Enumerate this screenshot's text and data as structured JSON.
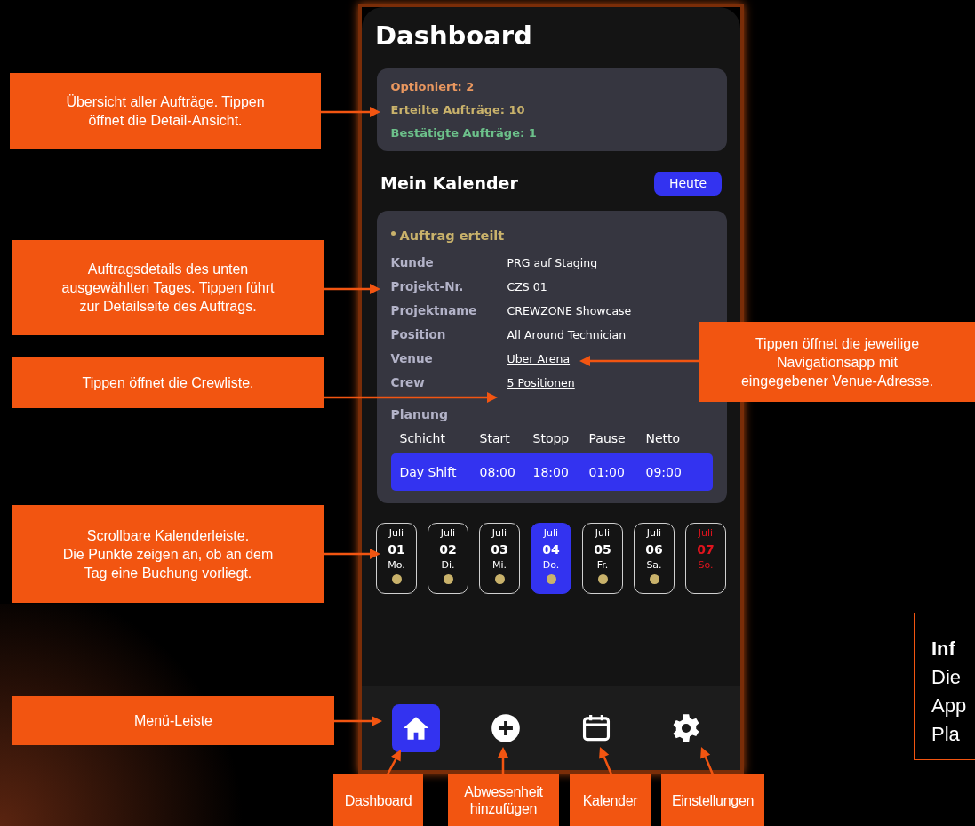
{
  "screen": {
    "title": "Dashboard",
    "summary": [
      {
        "text": "Optioniert: 2",
        "color": "#e9975f"
      },
      {
        "text": "Erteilte Aufträge: 10",
        "color": "#c9b26b"
      },
      {
        "text": "Bestätigte Aufträge: 1",
        "color": "#6cc08a"
      }
    ],
    "calendar_title": "Mein Kalender",
    "today_button": "Heute",
    "order": {
      "status": "Auftrag erteilt",
      "fields": [
        {
          "label": "Kunde",
          "value": "PRG auf Staging",
          "kind": "text"
        },
        {
          "label": "Projekt-Nr.",
          "value": "CZS 01",
          "kind": "text"
        },
        {
          "label": "Projektname",
          "value": "CREWZONE Showcase",
          "kind": "text"
        },
        {
          "label": "Position",
          "value": "All Around Technician",
          "kind": "text"
        },
        {
          "label": "Venue",
          "value": "Uber Arena",
          "kind": "link"
        },
        {
          "label": "Crew",
          "value": "5 Positionen",
          "kind": "link"
        }
      ],
      "planning_title": "Planung",
      "shift_columns": [
        "Schicht",
        "Start",
        "Stopp",
        "Pause",
        "Netto"
      ],
      "shifts": [
        {
          "cells": [
            "Day Shift",
            "08:00",
            "18:00",
            "01:00",
            "09:00"
          ],
          "selected": true
        }
      ]
    },
    "days": [
      {
        "month": "Juli",
        "day": "01",
        "weekday": "Mo.",
        "selected": false,
        "booked": true,
        "holiday": false
      },
      {
        "month": "Juli",
        "day": "02",
        "weekday": "Di.",
        "selected": false,
        "booked": true,
        "holiday": false
      },
      {
        "month": "Juli",
        "day": "03",
        "weekday": "Mi.",
        "selected": false,
        "booked": true,
        "holiday": false
      },
      {
        "month": "Juli",
        "day": "04",
        "weekday": "Do.",
        "selected": true,
        "booked": true,
        "holiday": false
      },
      {
        "month": "Juli",
        "day": "05",
        "weekday": "Fr.",
        "selected": false,
        "booked": true,
        "holiday": false
      },
      {
        "month": "Juli",
        "day": "06",
        "weekday": "Sa.",
        "selected": false,
        "booked": true,
        "holiday": false
      },
      {
        "month": "Juli",
        "day": "07",
        "weekday": "So.",
        "selected": false,
        "booked": false,
        "holiday": true
      }
    ],
    "nav": [
      {
        "kind": "home",
        "selected": true
      },
      {
        "kind": "add",
        "selected": false
      },
      {
        "kind": "calendar",
        "selected": false
      },
      {
        "kind": "settings",
        "selected": false
      }
    ]
  },
  "annotations": [
    {
      "lines": [
        "Übersicht aller Aufträge. Tippen",
        "öffnet die Detail-Ansicht."
      ]
    },
    {
      "lines": [
        "Auftragsdetails des unten",
        "ausgewählten Tages. Tippen führt",
        "zur Detailseite des Auftrags."
      ]
    },
    {
      "lines": [
        "Tippen öffnet die Crewliste."
      ]
    },
    {
      "lines": [
        "Scrollbare Kalenderleiste.",
        "Die Punkte zeigen an, ob an dem",
        "Tag eine Buchung vorliegt."
      ]
    },
    {
      "lines": [
        "Menü-Leiste"
      ]
    },
    {
      "lines": [
        "Tippen öffnet die jeweilige",
        "Navigationsapp mit",
        "eingegebener Venue-Adresse."
      ]
    }
  ],
  "menu_labels": [
    {
      "lines": [
        "Dashboard"
      ]
    },
    {
      "lines": [
        "Abwesenheit",
        "hinzufügen"
      ]
    },
    {
      "lines": [
        "Kalender"
      ]
    },
    {
      "lines": [
        "Einstellungen"
      ]
    }
  ],
  "info_box": {
    "title": "Inf",
    "lines": [
      "Die",
      "App",
      "Pla"
    ]
  }
}
